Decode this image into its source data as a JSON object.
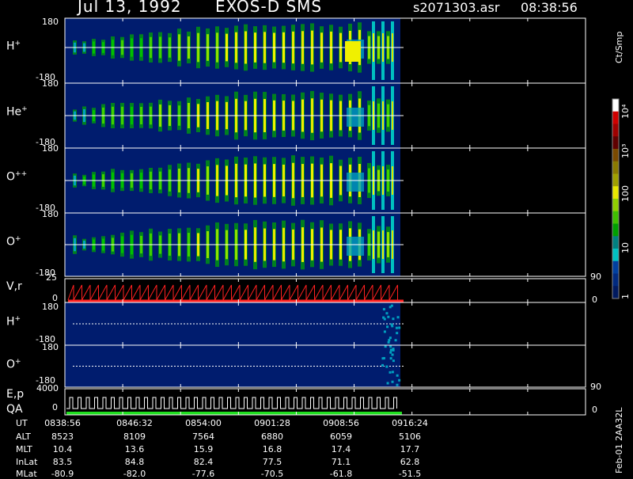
{
  "header": {
    "date": "Jul 13, 1992",
    "instrument": "EXOS-D SMS",
    "file": "s2071303.asr",
    "time": "08:38:56"
  },
  "colorbar": {
    "unit": "Ct/Smp",
    "ticks": [
      "10⁴",
      "10³",
      "100",
      "10",
      "1"
    ],
    "colors": [
      "#ffffff",
      "#d00000",
      "#a00000",
      "#600000",
      "#7a4a00",
      "#8a7a00",
      "#a0a000",
      "#e8e800",
      "#90d000",
      "#40c000",
      "#00a000",
      "#008080",
      "#00c0c0",
      "#0040a0",
      "#002a80",
      "#001a60"
    ]
  },
  "panels": [
    {
      "label": "H",
      "sup": "+",
      "ymax": "180",
      "ymin": "-180"
    },
    {
      "label": "He",
      "sup": "+",
      "ymax": "180",
      "ymin": "-180"
    },
    {
      "label": "O",
      "sup": "++",
      "ymax": "180",
      "ymin": "-180"
    },
    {
      "label": "O",
      "sup": "+",
      "ymax": "180",
      "ymin": "-180"
    }
  ],
  "vr_panel": {
    "label": "V,r",
    "ymax": "25",
    "ymin": "0",
    "right_top": "90",
    "right_bottom": "0"
  },
  "lower_panels": [
    {
      "label": "H",
      "sup": "+",
      "ymax": "180",
      "ymin": "-180"
    },
    {
      "label": "O",
      "sup": "+",
      "ymax": "180",
      "ymin": "-180"
    }
  ],
  "ep_panel": {
    "label1": "E,p",
    "label2": "QA",
    "ymax": "4000",
    "ymin": "0",
    "right_top": "90",
    "right_bottom": "0"
  },
  "footer": {
    "labels": [
      "UT",
      "ALT",
      "MLT",
      "InLat",
      "MLat"
    ],
    "columns": [
      [
        "0838:56",
        "8523",
        "10.4",
        "83.5",
        "-80.9"
      ],
      [
        "0846:32",
        "8109",
        "13.6",
        "84.8",
        "-82.0"
      ],
      [
        "0854:00",
        "7564",
        "15.9",
        "82.4",
        "-77.6"
      ],
      [
        "0901:28",
        "6880",
        "16.8",
        "77.5",
        "-70.5"
      ],
      [
        "0908:56",
        "6059",
        "17.4",
        "71.1",
        "-61.8"
      ],
      [
        "0916:24",
        "5106",
        "17.7",
        "62.8",
        "-51.5"
      ]
    ]
  },
  "side_note": "Feb-01 2AA32L",
  "chart_data": {
    "type": "heatmap",
    "title": "Jul 13, 1992 EXOS-D SMS",
    "xlabel": "UT",
    "x_ticks": [
      "0838:56",
      "0846:32",
      "0854:00",
      "0901:28",
      "0908:56",
      "0916:24"
    ],
    "ylim_pitch": [
      -180,
      180
    ],
    "series": [
      {
        "name": "H+"
      },
      {
        "name": "He+"
      },
      {
        "name": "O++"
      },
      {
        "name": "O+"
      }
    ],
    "color_scale": "log",
    "color_range": [
      1,
      10000
    ]
  }
}
